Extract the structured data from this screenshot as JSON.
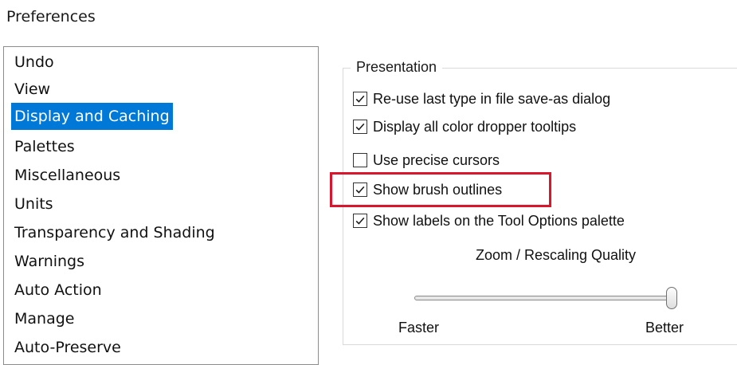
{
  "window": {
    "title": "Preferences"
  },
  "categories": {
    "items": [
      {
        "label": "Undo",
        "selected": false
      },
      {
        "label": "View",
        "selected": false
      },
      {
        "label": "Display and Caching",
        "selected": true
      },
      {
        "label": "Palettes",
        "selected": false
      },
      {
        "label": "Miscellaneous",
        "selected": false
      },
      {
        "label": "Units",
        "selected": false
      },
      {
        "label": "Transparency and Shading",
        "selected": false
      },
      {
        "label": "Warnings",
        "selected": false
      },
      {
        "label": "Auto Action",
        "selected": false
      },
      {
        "label": "Manage",
        "selected": false
      },
      {
        "label": "Auto-Preserve",
        "selected": false
      }
    ]
  },
  "presentation": {
    "title": "Presentation",
    "options": [
      {
        "label": "Re-use last type in file save-as dialog",
        "checked": true
      },
      {
        "label": "Display all color dropper tooltips",
        "checked": true
      },
      {
        "label": "Use precise cursors",
        "checked": false
      },
      {
        "label": "Show brush outlines",
        "checked": true,
        "highlighted": true
      },
      {
        "label": "Show labels on the Tool Options palette",
        "checked": true
      }
    ],
    "zoom": {
      "label": "Zoom / Rescaling Quality",
      "min_label": "Faster",
      "max_label": "Better",
      "value": 1.0
    }
  },
  "colors": {
    "selection": "#0078d7",
    "highlight": "#d9162b"
  },
  "icons": {
    "checked": "checkmark-icon"
  }
}
